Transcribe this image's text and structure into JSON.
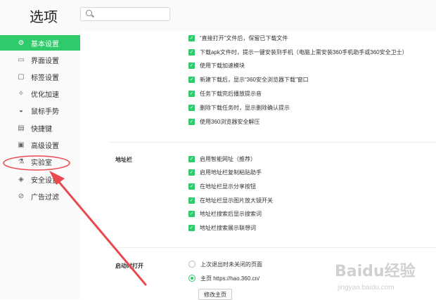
{
  "window": {
    "title": "选项"
  },
  "search": {
    "placeholder": ""
  },
  "sidebar": {
    "items": [
      {
        "label": "基本设置",
        "icon": "gear-icon",
        "active": true
      },
      {
        "label": "界面设置",
        "icon": "window-icon"
      },
      {
        "label": "标签设置",
        "icon": "tab-icon"
      },
      {
        "label": "优化加速",
        "icon": "rocket-icon"
      },
      {
        "label": "鼠标手势",
        "icon": "mouse-icon"
      },
      {
        "label": "快捷键",
        "icon": "keyboard-icon"
      },
      {
        "label": "高级设置",
        "icon": "advanced-icon"
      },
      {
        "label": "实验室",
        "icon": "flask-icon"
      },
      {
        "label": "安全设置",
        "icon": "shield-icon"
      },
      {
        "label": "广告过滤",
        "icon": "block-icon"
      }
    ]
  },
  "download": {
    "options": [
      "“直接打开”文件后，保留已下载文件",
      "下载apk文件时，提示一键安装到手机（电脑上需安装360手机助手或360安全卫士）",
      "使用下载加速模块",
      "新建下载后，显示“360安全浏览器下载”窗口",
      "任务下载完后播放提示音",
      "删除下载任务时，显示删除确认提示",
      "使用360浏览器安全解压"
    ]
  },
  "addressbar": {
    "label": "地址栏",
    "options": [
      "启用智能网址（推荐）",
      "启用地址栏复制粘贴助手",
      "在地址栏显示分享按钮",
      "在地址栏显示图片放大镜开关",
      "地址栏搜索后显示搜索词",
      "地址栏搜索展示联想词"
    ]
  },
  "startup": {
    "label": "启动时打开",
    "options": [
      {
        "label": "上次退出时未关闭的页面",
        "checked": false
      },
      {
        "label": "主页  https://hao.360.cn/",
        "checked": true
      }
    ],
    "button_label": "修改主页"
  },
  "watermark": {
    "brand": "Baidu经验",
    "url": "jingyan.baidu.com"
  },
  "colors": {
    "accent": "#2fcb6b",
    "annotation": "#e8494f"
  }
}
